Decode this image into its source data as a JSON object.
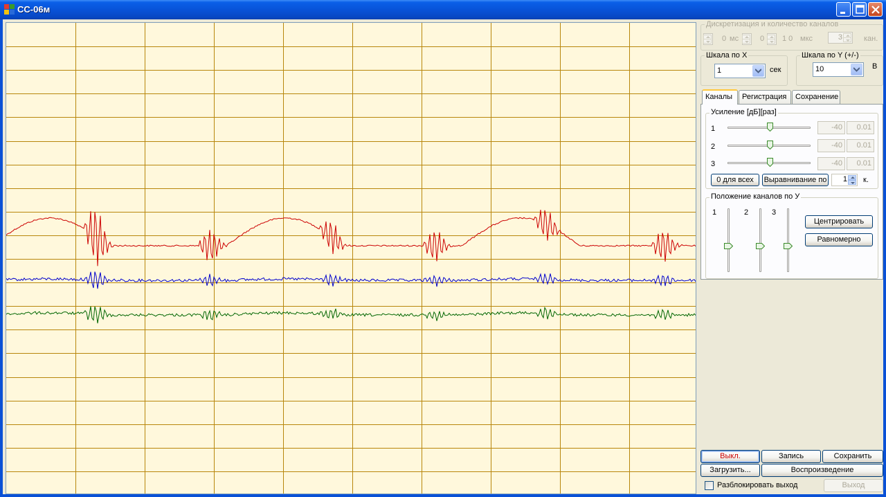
{
  "window": {
    "title": "СС-06м"
  },
  "discretization": {
    "legend": "Дискретизация и количество каналов",
    "ms_value": "0",
    "ms_unit": "мс",
    "us_value_1": "0",
    "us_value_2": "1 0",
    "us_unit": "мкс",
    "channels_value": "3",
    "channels_unit": "кан."
  },
  "scale_x": {
    "legend": "Шкала по X",
    "value": "1",
    "unit": "сек"
  },
  "scale_y": {
    "legend": "Шкала по Y (+/-)",
    "value": "10",
    "unit": "В"
  },
  "tabs": [
    {
      "label": "Каналы",
      "active": true
    },
    {
      "label": "Регистрация",
      "active": false
    },
    {
      "label": "Сохранение",
      "active": false
    }
  ],
  "gain": {
    "legend": "Усиление [дБ][раз]",
    "channels": [
      {
        "label": "1",
        "db": "-40",
        "ratio": "0.01"
      },
      {
        "label": "2",
        "db": "-40",
        "ratio": "0.01"
      },
      {
        "label": "3",
        "db": "-40",
        "ratio": "0.01"
      }
    ],
    "zero_all_label": "0 для всех",
    "align_label": "Выравнивание по",
    "align_value": "1",
    "align_unit": "к."
  },
  "position": {
    "legend": "Положение каналов по У",
    "channels": [
      "1",
      "2",
      "3"
    ],
    "center_label": "Центрировать",
    "even_label": "Равномерно"
  },
  "bottom": {
    "off_label": "Выкл.",
    "record_label": "Запись",
    "save_label": "Сохранить",
    "load_label": "Загрузить...",
    "play_label": "Воспроизведение",
    "unlock_label": "Разблокировать выход",
    "exit_label": "Выход"
  },
  "colors": {
    "plot_background": "#fff8dc",
    "grid": "#b8860b",
    "channel_1": "#cc0000",
    "channel_2": "#0000cc",
    "channel_3": "#006600"
  }
}
